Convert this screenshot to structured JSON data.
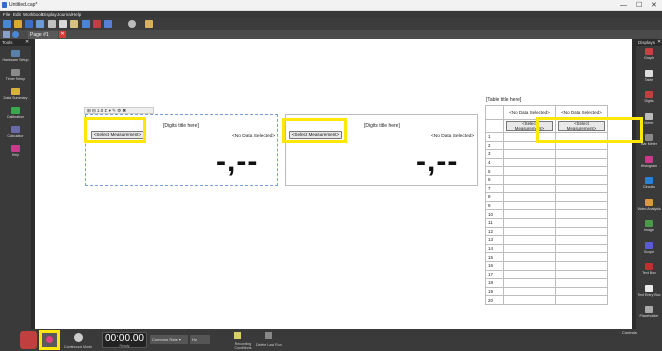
{
  "window": {
    "title": "Untitled.cap*",
    "minimize": "—",
    "maximize": "☐",
    "close": "✕"
  },
  "menu": [
    "File",
    "Edit",
    "Workbook",
    "Display",
    "Journal",
    "Help"
  ],
  "page_tab": {
    "label": "Page #1"
  },
  "tools": {
    "header": "Tools",
    "close": "✕",
    "items": [
      {
        "label": "Hardware Setup",
        "icon": "hardware-icon",
        "color": "#5a7fa8"
      },
      {
        "label": "Timer Setup",
        "icon": "timer-icon",
        "color": "#8a8a8a"
      },
      {
        "label": "Data Summary",
        "icon": "data-summary-icon",
        "color": "#d8b33a"
      },
      {
        "label": "Calibration",
        "icon": "calibration-icon",
        "color": "#3aa84f"
      },
      {
        "label": "Calculator",
        "icon": "calculator-icon",
        "color": "#6a6aa8"
      },
      {
        "label": "Help",
        "icon": "help-icon",
        "color": "#c93a8a"
      }
    ]
  },
  "displays": {
    "header": "Displays",
    "close": "✕",
    "items": [
      {
        "label": "Graph",
        "icon": "graph-icon",
        "color": "#c94040"
      },
      {
        "label": "Table",
        "icon": "table-icon",
        "color": "#dddddd"
      },
      {
        "label": "Digits",
        "icon": "digits-icon",
        "color": "#c04040"
      },
      {
        "label": "Meter",
        "icon": "meter-icon",
        "color": "#bbbbbb"
      },
      {
        "label": "Bar Meter",
        "icon": "bar-meter-icon",
        "color": "#8a8a8a"
      },
      {
        "label": "Histogram",
        "icon": "histogram-icon",
        "color": "#c93a8a"
      },
      {
        "label": "Circuits",
        "icon": "circuits-icon",
        "color": "#2a7fd8"
      },
      {
        "label": "Video Analysis",
        "icon": "video-icon",
        "color": "#d89a3a"
      },
      {
        "label": "Image",
        "icon": "image-icon",
        "color": "#4a9a4a"
      },
      {
        "label": "Scope",
        "icon": "scope-icon",
        "color": "#5a5ad8"
      },
      {
        "label": "Text Box",
        "icon": "text-box-icon",
        "color": "#c03030"
      },
      {
        "label": "Text Entry Box",
        "icon": "text-entry-icon",
        "color": "#eaeaea"
      },
      {
        "label": "Placeholder",
        "icon": "placeholder-icon",
        "color": "#aaaaaa"
      }
    ]
  },
  "digits1": {
    "title": "[Digits title here]",
    "select": "<Select Measurement>",
    "no_data": "<No Data Selected>",
    "value": "-,--",
    "toolbar": "⊞ ⊟ 1.0 Σ ▾ ✎ ⚙ ✖"
  },
  "digits2": {
    "title": "[Digits title here]",
    "select": "<Select Measurement>",
    "no_data": "<No Data Selected>",
    "value": "-,--"
  },
  "table": {
    "title": "[Table title here]",
    "col1_top": "<No Data Selected>",
    "col2_top": "<No Data Selected>",
    "col1_select": "<Select Measurement>",
    "col2_select": "<Select Measurement>",
    "rows": [
      "1",
      "2",
      "3",
      "4",
      "5",
      "6",
      "7",
      "8",
      "9",
      "10",
      "11",
      "12",
      "13",
      "14",
      "15",
      "16",
      "17",
      "18",
      "19",
      "20"
    ]
  },
  "bottom": {
    "timer": "00:00.00",
    "timer_label": "Ready",
    "rate_label": "Common Rate ▾",
    "rate_value": "Hz",
    "mode_label": "Continuous Mode",
    "recording_label": "Recording Conditions",
    "delete_label": "Delete Last Run",
    "controls": "Controls"
  },
  "colors": {
    "highlight": "#ffe70a",
    "panel": "#3a3a3a"
  }
}
